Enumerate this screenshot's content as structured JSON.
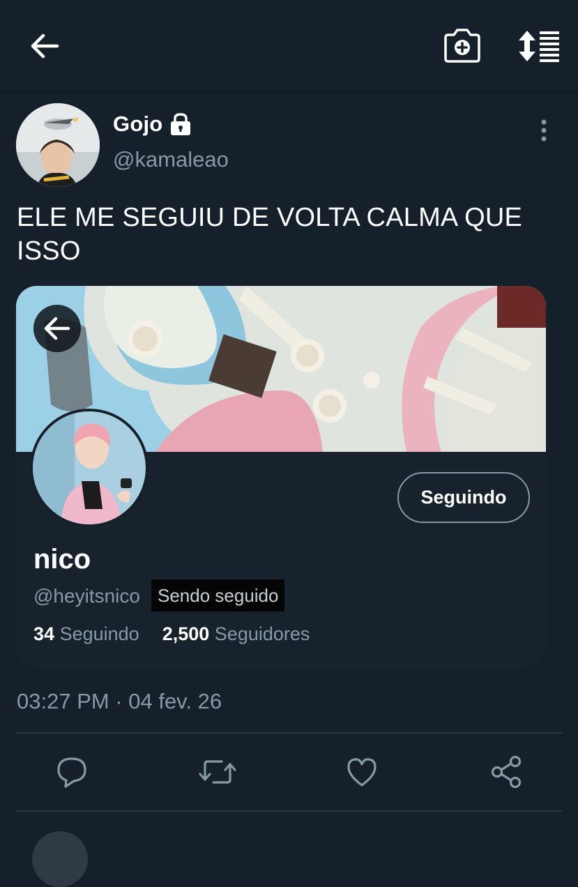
{
  "header": {
    "back_icon": "arrow-left-icon",
    "camera_icon": "camera-plus-icon",
    "sort_icon": "sort-list-icon"
  },
  "tweet": {
    "author_name": "Gojo",
    "author_handle": "@kamaleao",
    "protected_icon": "lock-icon",
    "text": "ELE ME SEGUIU DE VOLTA CALMA QUE ISSO",
    "timestamp": "03:27 PM · 04 fev. 26"
  },
  "profile_card": {
    "name": "nico",
    "handle": "@heyitsnico",
    "follows_you_label": "Sendo seguido",
    "follow_button_label": "Seguindo",
    "following_count": "34",
    "following_label": "Seguindo",
    "followers_count": "2,500",
    "followers_label": "Seguidores"
  },
  "actions": [
    "reply-icon",
    "retweet-icon",
    "like-icon",
    "share-icon"
  ],
  "colors": {
    "background": "#15202b",
    "secondary_text": "#8899a6",
    "primary_text": "#ffffff"
  }
}
